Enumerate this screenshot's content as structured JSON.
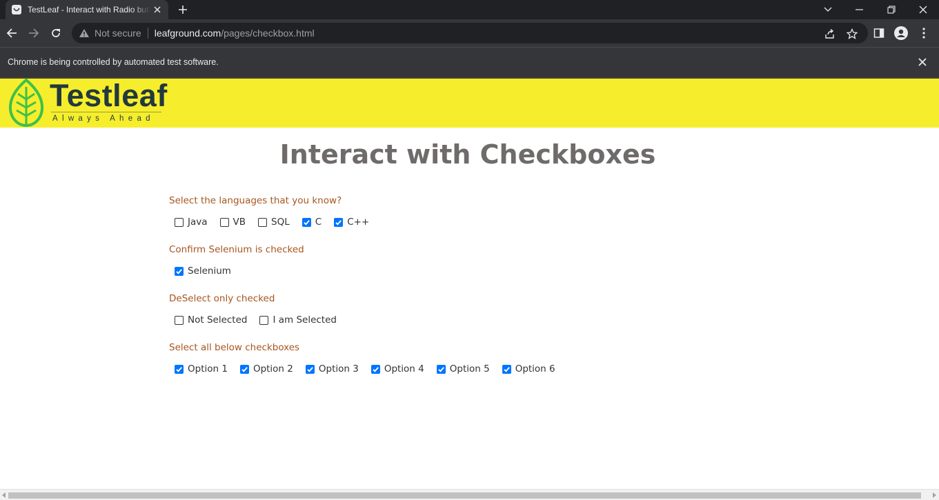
{
  "browser": {
    "tab_title": "TestLeaf - Interact with Radio buttons",
    "omnibox": {
      "security_text": "Not secure",
      "url_host": "leafground.com",
      "url_path": "/pages/checkbox.html"
    },
    "infobar_text": "Chrome is being controlled by automated test software."
  },
  "header": {
    "logo_word": "Testleaf",
    "logo_tagline": "Always Ahead"
  },
  "page": {
    "title": "Interact with Checkboxes",
    "sections": [
      {
        "label": "Select the languages that you know?",
        "options": [
          {
            "label": "Java",
            "checked": false
          },
          {
            "label": "VB",
            "checked": false
          },
          {
            "label": "SQL",
            "checked": false
          },
          {
            "label": "C",
            "checked": true
          },
          {
            "label": "C++",
            "checked": true
          }
        ]
      },
      {
        "label": "Confirm Selenium is checked",
        "options": [
          {
            "label": "Selenium",
            "checked": true
          }
        ]
      },
      {
        "label": "DeSelect only checked",
        "options": [
          {
            "label": "Not Selected",
            "checked": false
          },
          {
            "label": "I am Selected",
            "checked": false
          }
        ]
      },
      {
        "label": "Select all below checkboxes",
        "options": [
          {
            "label": "Option 1",
            "checked": true
          },
          {
            "label": "Option 2",
            "checked": true
          },
          {
            "label": "Option 3",
            "checked": true
          },
          {
            "label": "Option 4",
            "checked": true
          },
          {
            "label": "Option 5",
            "checked": true
          },
          {
            "label": "Option 6",
            "checked": true
          }
        ]
      }
    ]
  },
  "colors": {
    "header_bg": "#f6ee2c",
    "section_label": "#a7551f",
    "checkbox_checked": "#0075ff",
    "title": "#6f6b6a"
  }
}
